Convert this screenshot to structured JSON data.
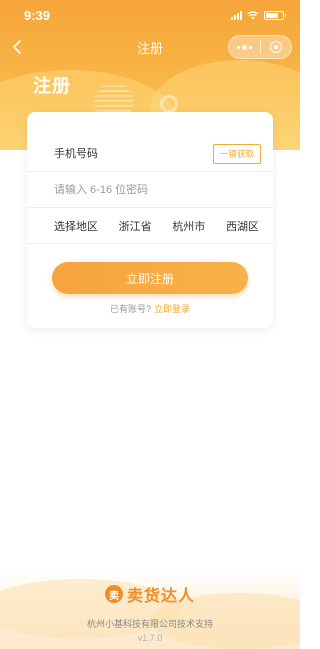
{
  "status_bar": {
    "time": "9:39"
  },
  "nav": {
    "title": "注册"
  },
  "page": {
    "heading": "注册"
  },
  "form": {
    "phone_placeholder": "手机号码",
    "code_button": "一键获取",
    "password_placeholder": "请输入 6-16 位密码",
    "region": {
      "label": "选择地区",
      "province": "浙江省",
      "city": "杭州市",
      "district": "西湖区"
    },
    "submit": "立即注册",
    "have_account": "已有账号?",
    "login_link": "立即登录"
  },
  "footer": {
    "logo_char": "卖",
    "brand": "卖货达人",
    "support": "杭州小基科技有限公司技术支持",
    "version": "v1.7.0"
  },
  "colors": {
    "accent": "#f6a33d",
    "brand": "#f08d2a"
  }
}
